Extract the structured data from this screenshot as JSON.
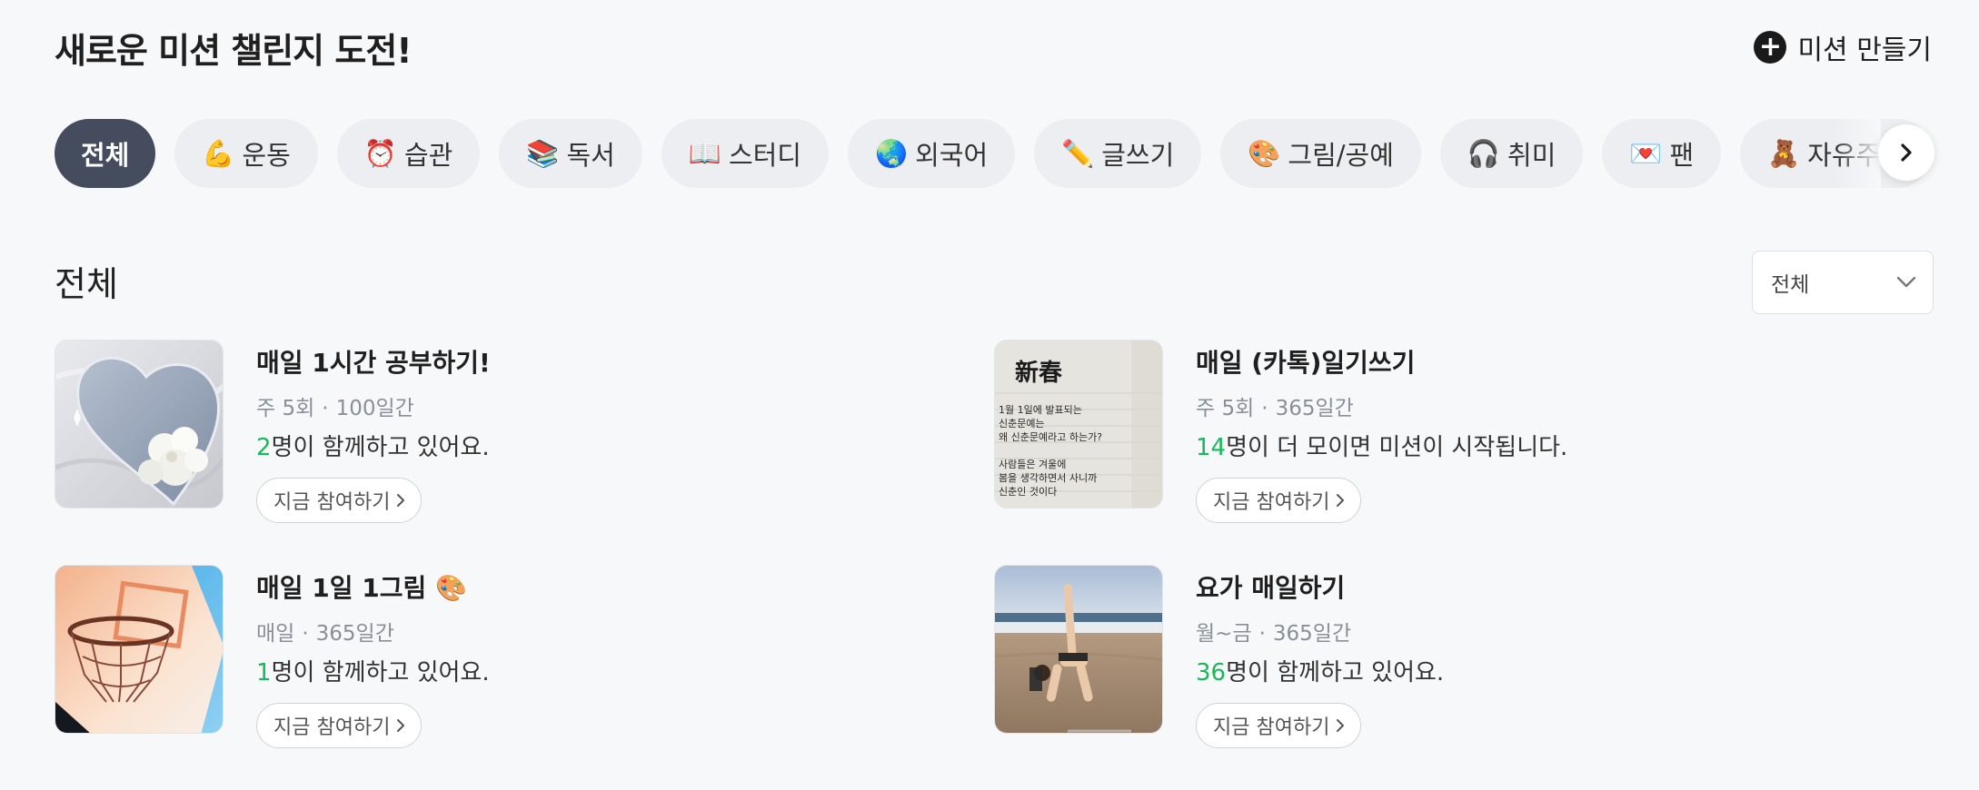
{
  "header": {
    "title": "새로운 미션 챌린지 도전!",
    "create_label": "미션 만들기"
  },
  "categories": [
    {
      "emoji": "",
      "label": "전체",
      "active": true
    },
    {
      "emoji": "💪",
      "label": "운동"
    },
    {
      "emoji": "⏰",
      "label": "습관"
    },
    {
      "emoji": "📚",
      "label": "독서"
    },
    {
      "emoji": "📖",
      "label": "스터디"
    },
    {
      "emoji": "🌏",
      "label": "외국어"
    },
    {
      "emoji": "✏️",
      "label": "글쓰기"
    },
    {
      "emoji": "🎨",
      "label": "그림/공예"
    },
    {
      "emoji": "🎧",
      "label": "취미"
    },
    {
      "emoji": "💌",
      "label": "팬"
    },
    {
      "emoji": "🧸",
      "label": "자유주제"
    }
  ],
  "section": {
    "title": "전체",
    "sort_value": "전체"
  },
  "missions": [
    {
      "title": "매일 1시간 공부하기!",
      "frequency": "주 5회",
      "duration": "100일간",
      "count": "2",
      "status_suffix": "명이 함께하고 있어요.",
      "join_label": "지금 참여하기",
      "thumb": "heart-mirror-flowers"
    },
    {
      "title": "매일 (카톡)일기쓰기",
      "frequency": "주 5회",
      "duration": "365일간",
      "count": "14",
      "status_suffix": "명이 더 모이면 미션이 시작됩니다.",
      "join_label": "지금 참여하기",
      "thumb": "handwritten-notebook"
    },
    {
      "title": "매일 1일 1그림 🎨",
      "frequency": "매일",
      "duration": "365일간",
      "count": "1",
      "status_suffix": "명이 함께하고 있어요.",
      "join_label": "지금 참여하기",
      "thumb": "basketball-hoop"
    },
    {
      "title": "요가 매일하기",
      "frequency": "월~금",
      "duration": "365일간",
      "count": "36",
      "status_suffix": "명이 함께하고 있어요.",
      "join_label": "지금 참여하기",
      "thumb": "beach-yoga"
    }
  ],
  "thumb_texts": {
    "notebook_heading": "新春",
    "notebook_lines": [
      "1월 1일에 발표되는",
      "신춘문예는",
      "왜 신춘문예라고 하는가?",
      "",
      "사람들은 겨울에",
      "봄을 생각하면서 사니까",
      "신춘인 것이다"
    ]
  },
  "colors": {
    "accent_green": "#19b85a",
    "chip_active": "#454c5e",
    "chip_bg": "#eceef1",
    "background": "#f7f8fa"
  }
}
